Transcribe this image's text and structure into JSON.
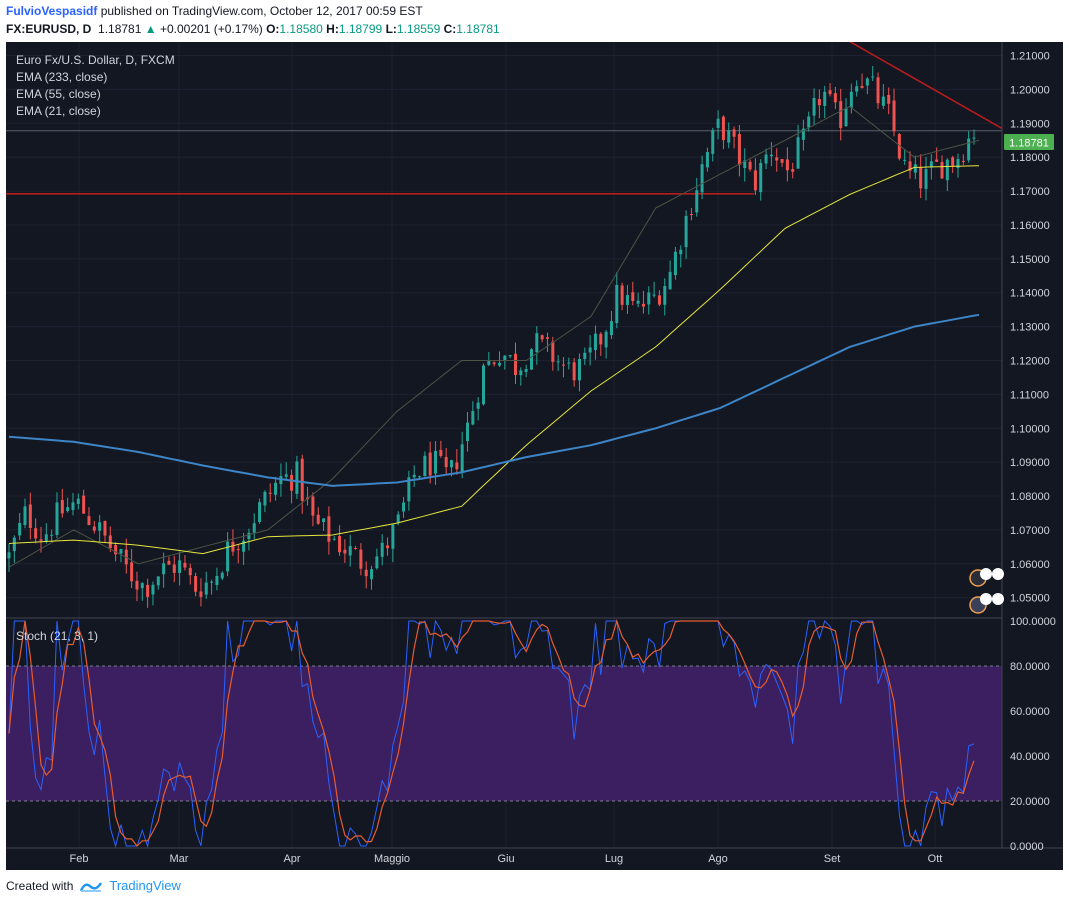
{
  "header": {
    "author": "FulvioVespasidf",
    "published_text": "published on TradingView.com, October 12, 2017 00:59 EST",
    "symbol": "FX:EURUSD, D",
    "last": "1.18781",
    "change": "+0.00201 (+0.17%)",
    "open_label": "O:",
    "open": "1.18580",
    "high_label": "H:",
    "high": "1.18799",
    "low_label": "L:",
    "low": "1.18559",
    "close_label": "C:",
    "close": "1.18781"
  },
  "legend": {
    "instrument": "Euro Fx/U.S. Dollar, D, FXCM",
    "ema233": "EMA (233, close)",
    "ema55": "EMA (55, close)",
    "ema21": "EMA (21, close)",
    "stoch": "Stoch (21, 3, 1)"
  },
  "footer": {
    "created_with": "Created with",
    "brand": "TradingView"
  },
  "colors": {
    "background": "#131722",
    "up": "#26a69a",
    "down": "#ef5350",
    "ema233": "#3d85c6",
    "ema55": "#e6e63c",
    "ema21": "#4b5545",
    "trendline": "#b71c1c",
    "stoch_k": "#2962ff",
    "stoch_d": "#e65c2e",
    "stoch_band": "#3b1f60"
  },
  "chart_data": {
    "type": "candlestick",
    "ylim": [
      1.044,
      1.214
    ],
    "price_ticks": [
      "1.21000",
      "1.20000",
      "1.19000",
      "1.18000",
      "1.17000",
      "1.16000",
      "1.15000",
      "1.14000",
      "1.13000",
      "1.12000",
      "1.11000",
      "1.10000",
      "1.09000",
      "1.08000",
      "1.07000",
      "1.06000",
      "1.05000"
    ],
    "last_price_label": "1.18781",
    "x_labels": [
      "Feb",
      "Mar",
      "Apr",
      "Maggio",
      "Giu",
      "Lug",
      "Ago",
      "Set",
      "Ott"
    ],
    "ema233_anchors": [
      1.0975,
      1.096,
      1.093,
      1.089,
      1.0855,
      1.083,
      1.084,
      1.087,
      1.0915,
      1.095,
      1.1,
      1.106,
      1.115,
      1.124,
      1.13,
      1.1335
    ],
    "ema55_anchors": [
      1.066,
      1.067,
      1.0655,
      1.063,
      1.068,
      1.0685,
      1.072,
      1.077,
      1.095,
      1.111,
      1.124,
      1.141,
      1.159,
      1.169,
      1.177,
      1.1775
    ],
    "ema21_anchors": [
      1.059,
      1.07,
      1.06,
      1.065,
      1.07,
      1.085,
      1.105,
      1.12,
      1.12,
      1.133,
      1.165,
      1.175,
      1.185,
      1.195,
      1.18,
      1.185
    ],
    "close_path": [
      1.062,
      1.075,
      1.068,
      1.075,
      1.078,
      1.072,
      1.065,
      1.058,
      1.053,
      1.058,
      1.06,
      1.053,
      1.055,
      1.065,
      1.07,
      1.078,
      1.085,
      1.086,
      1.072,
      1.068,
      1.064,
      1.06,
      1.063,
      1.072,
      1.087,
      1.09,
      1.085,
      1.099,
      1.117,
      1.123,
      1.118,
      1.125,
      1.122,
      1.117,
      1.118,
      1.127,
      1.14,
      1.135,
      1.138,
      1.145,
      1.162,
      1.178,
      1.19,
      1.181,
      1.172,
      1.183,
      1.176,
      1.185,
      1.2,
      1.19,
      1.205,
      1.2,
      1.192,
      1.175,
      1.173,
      1.178,
      1.18,
      1.188
    ],
    "horizontal_level": 1.1692,
    "trendline": {
      "from": 1.2215,
      "to": 1.1885
    },
    "stoch": {
      "ylim": [
        0,
        100
      ],
      "ticks": [
        "100.0000",
        "80.0000",
        "60.0000",
        "40.0000",
        "20.0000",
        "0.0000"
      ],
      "band": [
        20,
        80
      ]
    }
  }
}
